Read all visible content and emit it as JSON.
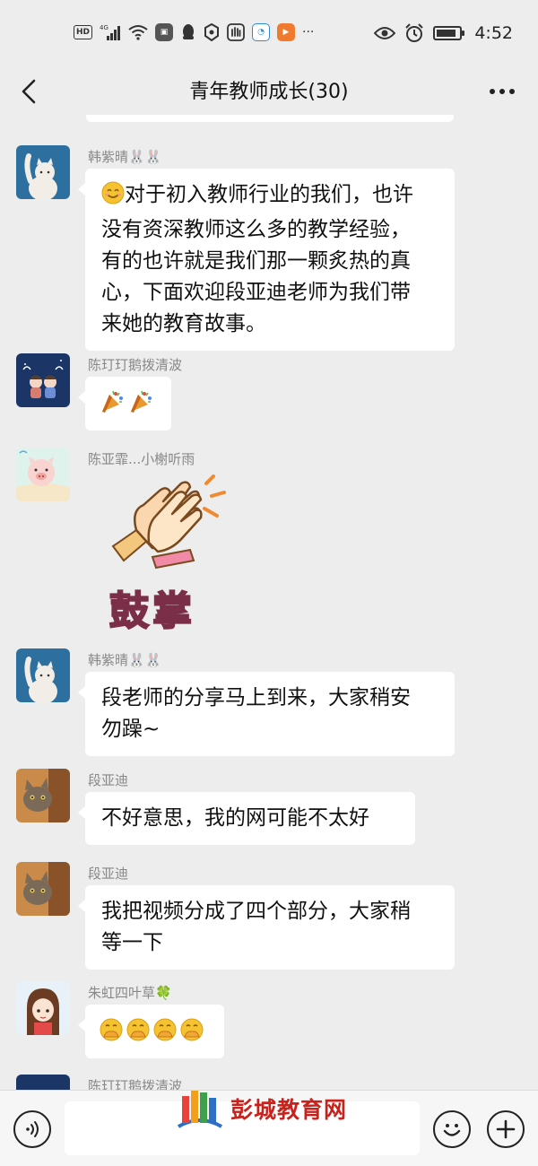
{
  "status_bar": {
    "time": "4:52",
    "hd_label": "HD",
    "network_label": "4G",
    "battery_level": 0.85
  },
  "nav": {
    "title": "青年教师成长(30)",
    "more_label": "···"
  },
  "messages": [
    {
      "sender": "韩紫晴🐰🐰",
      "text": "对于初入教师行业的我们，也许\n没有资深教师这么多的教学经验，\n有的也许就是我们那一颗炙热的真\n心，下面欢迎段亚迪老师为我们带\n来她的教育故事。",
      "leading_emoji": "smile-emoji"
    },
    {
      "sender": "陈玎玎鹅拨清波",
      "emojis": "🎉🎉"
    },
    {
      "sender": "陈亚霏...小榭听雨",
      "sticker_text": "鼓掌"
    },
    {
      "sender": "韩紫晴🐰🐰",
      "text": "段老师的分享马上到来，大家稍安\n勿躁~"
    },
    {
      "sender": "段亚迪",
      "text": "不好意思，我的网可能不太好"
    },
    {
      "sender": "段亚迪",
      "text": "我把视频分成了四个部分，大家稍\n等一下"
    },
    {
      "sender": "朱虹四叶草🍀",
      "emojis": "🤭🤭🤭🤭"
    },
    {
      "sender": "陈玎玎鹅拨清波"
    }
  ],
  "watermark": {
    "text": "彭城教育网"
  },
  "colors": {
    "background": "#ededed",
    "bubble": "#ffffff",
    "sender": "#888888",
    "watermark": "#c8221c"
  }
}
